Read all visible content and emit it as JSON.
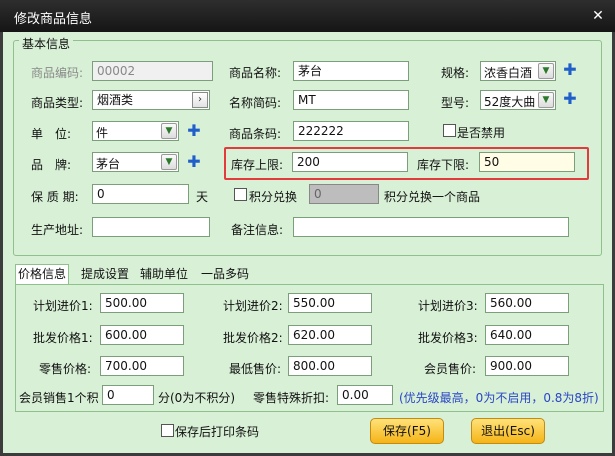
{
  "window": {
    "title": "修改商品信息"
  },
  "basic": {
    "legend": "基本信息",
    "code": {
      "label": "商品编码:",
      "value": "00002"
    },
    "name": {
      "label": "商品名称:",
      "value": "茅台"
    },
    "spec": {
      "label": "规格:",
      "value": "浓香白酒"
    },
    "category": {
      "label": "商品类型:",
      "value": "烟酒类"
    },
    "short_name": {
      "label": "名称简码:",
      "value": "MT"
    },
    "model": {
      "label": "型号:",
      "value": "52度大曲"
    },
    "unit": {
      "label": "单　位:",
      "value": "件"
    },
    "barcode": {
      "label": "商品条码:",
      "value": "222222"
    },
    "disabled": {
      "label": "是否禁用"
    },
    "brand": {
      "label": "品　牌:",
      "value": "茅台"
    },
    "stock_upper": {
      "label": "库存上限:",
      "value": "200"
    },
    "stock_lower": {
      "label": "库存下限:",
      "value": "50"
    },
    "shelf_life": {
      "label": "保 质 期:",
      "value": "0",
      "unit": "天"
    },
    "points": {
      "label": "积分兑换",
      "value": "0",
      "suffix": "积分兑换一个商品"
    },
    "origin": {
      "label": "生产地址:",
      "value": ""
    },
    "remark": {
      "label": "备注信息:",
      "value": ""
    }
  },
  "tabs": [
    {
      "label": "价格信息",
      "active": true
    },
    {
      "label": "提成设置",
      "active": false
    },
    {
      "label": "辅助单位",
      "active": false
    },
    {
      "label": "一品多码",
      "active": false
    }
  ],
  "prices": {
    "plan1": {
      "label": "计划进价1:",
      "value": "500.00"
    },
    "plan2": {
      "label": "计划进价2:",
      "value": "550.00"
    },
    "plan3": {
      "label": "计划进价3:",
      "value": "560.00"
    },
    "whole1": {
      "label": "批发价格1:",
      "value": "600.00"
    },
    "whole2": {
      "label": "批发价格2:",
      "value": "620.00"
    },
    "whole3": {
      "label": "批发价格3:",
      "value": "640.00"
    },
    "retail": {
      "label": "零售价格:",
      "value": "700.00"
    },
    "min": {
      "label": "最低售价:",
      "value": "800.00"
    },
    "member": {
      "label": "会员售价:",
      "value": "900.00"
    },
    "member_points": {
      "label": "会员销售1个积",
      "value": "0",
      "suffix": "分(0为不积分)"
    },
    "special_discount": {
      "label": "零售特殊折扣:",
      "value": "0.00"
    },
    "note": "(优先级最高，0为不启用，0.8为8折)"
  },
  "footer": {
    "print_after_save": "保存后打印条码",
    "save": "保存(F5)",
    "exit": "退出(Esc)"
  },
  "colors": {
    "accent_button": "#f5b417",
    "highlight_box": "#e33b3b",
    "panel_bg": "#d8f0d6"
  }
}
